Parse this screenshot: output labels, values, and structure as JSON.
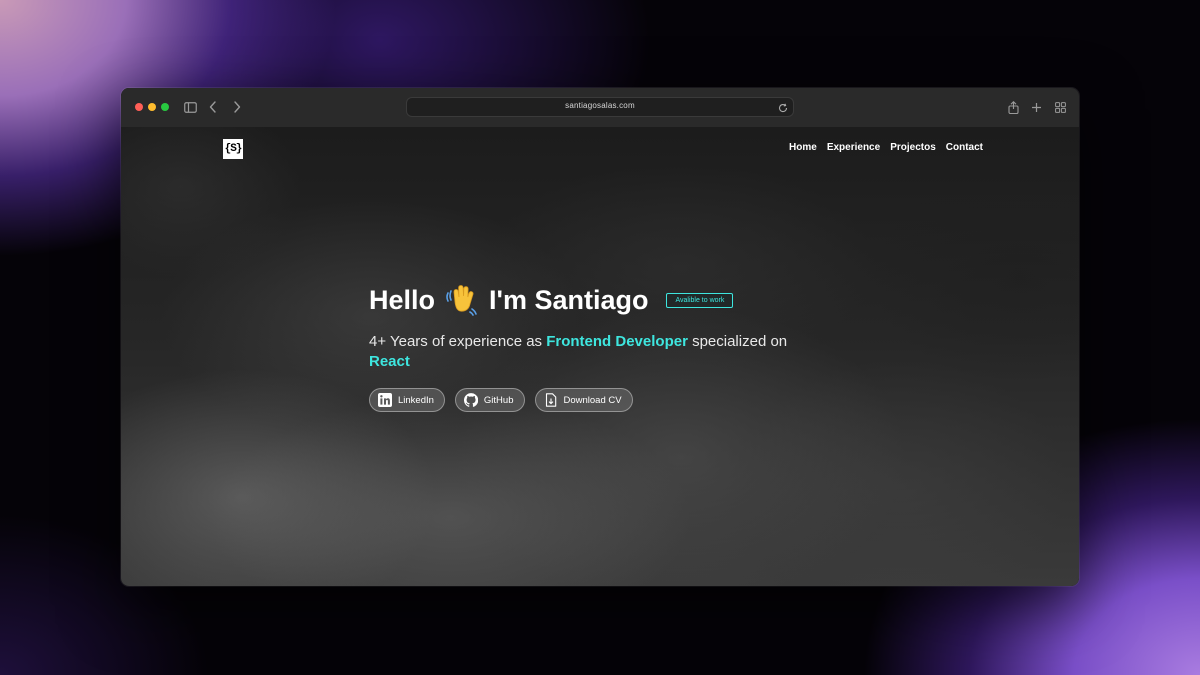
{
  "browser": {
    "url": "santiagosalas.com",
    "icons": [
      "sidebar-icon",
      "back-icon",
      "forward-icon",
      "reload-icon",
      "share-icon",
      "new-tab-icon",
      "tab-overview-icon"
    ]
  },
  "site": {
    "logo": "{S}",
    "nav": [
      {
        "label": "Home"
      },
      {
        "label": "Experience"
      },
      {
        "label": "Projectos"
      },
      {
        "label": "Contact"
      }
    ]
  },
  "hero": {
    "greeting": "Hello",
    "emoji": "waving-hand-icon",
    "name_text": "I'm Santiago",
    "badge": "Avalible to work",
    "subtitle_pre": "4+ Years of experience as ",
    "subtitle_role": "Frontend Developer",
    "subtitle_mid": " specialized on ",
    "subtitle_tech": "React",
    "buttons": [
      {
        "label": "LinkedIn",
        "icon": "linkedin-icon"
      },
      {
        "label": "GitHub",
        "icon": "github-icon"
      },
      {
        "label": "Download CV",
        "icon": "download-file-icon"
      }
    ]
  },
  "colors": {
    "accent": "#3ee6df",
    "text": "#ffffff",
    "toolbar": "#2a2a2a"
  }
}
